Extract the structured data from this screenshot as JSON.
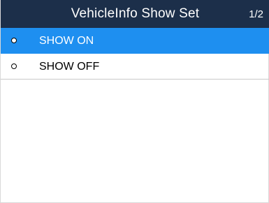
{
  "header": {
    "title": "VehicleInfo Show Set",
    "page_indicator": "1/2"
  },
  "options": [
    {
      "label": "SHOW ON",
      "selected": true
    },
    {
      "label": "SHOW OFF",
      "selected": false
    }
  ],
  "colors": {
    "header_bg": "#1c2f4a",
    "selection_bg": "#1e8ff0",
    "text": "#000000",
    "header_text": "#ffffff"
  }
}
